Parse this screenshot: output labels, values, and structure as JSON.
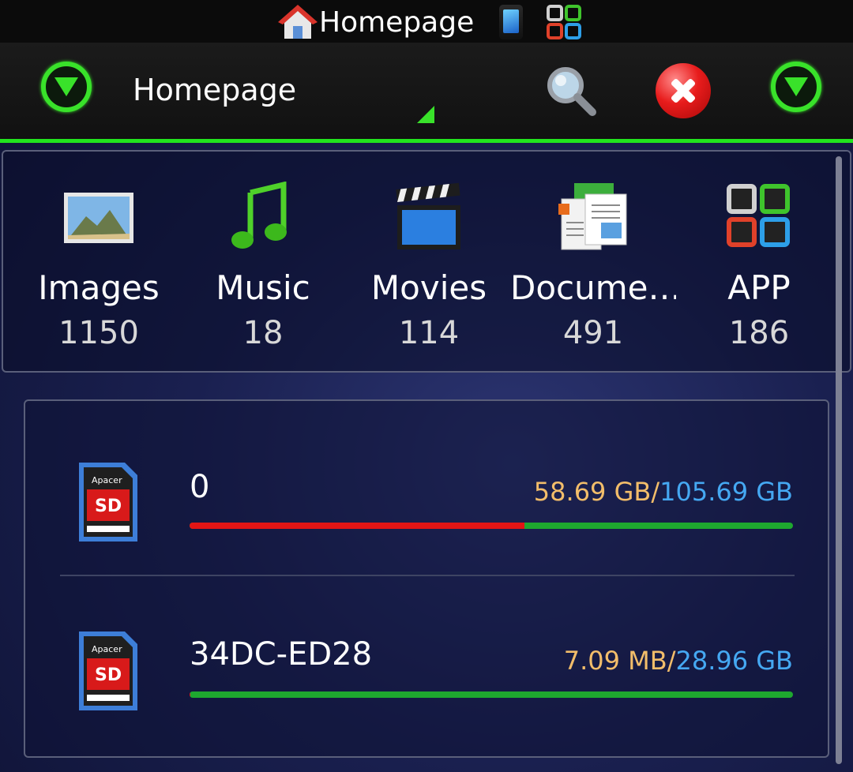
{
  "status_strip": {
    "title": "Homepage",
    "icons": [
      "house-icon",
      "phone-icon",
      "app-grid-icon"
    ]
  },
  "toolbar": {
    "title": "Homepage",
    "buttons": [
      "green-down-circle-icon",
      "search-icon",
      "close-icon",
      "green-down-circle-icon"
    ]
  },
  "categories": [
    {
      "label": "Images",
      "count": "1150",
      "icon": "images-icon"
    },
    {
      "label": "Music",
      "count": "18",
      "icon": "music-note-icon"
    },
    {
      "label": "Movies",
      "count": "114",
      "icon": "clapperboard-icon"
    },
    {
      "label": "Docume…",
      "count": "491",
      "icon": "documents-icon"
    },
    {
      "label": "APP",
      "count": "186",
      "icon": "app-grid-icon"
    }
  ],
  "storage": [
    {
      "name": "0",
      "used": "58.69 GB",
      "separator": "/",
      "total": "105.69 GB",
      "used_fraction": 0.555,
      "icon": "sd-card-icon",
      "card_brand": "Apacer"
    },
    {
      "name": "34DC-ED28",
      "used": "7.09 MB",
      "separator": "/",
      "total": "28.96 GB",
      "used_fraction": 0.0002,
      "icon": "sd-card-icon",
      "card_brand": "Apacer"
    }
  ],
  "colors": {
    "accent_green": "#22e41e",
    "used_text": "#f2bd6a",
    "total_text": "#45a8f2",
    "bar_used": "#e21515",
    "bar_free": "#1ea82f"
  }
}
